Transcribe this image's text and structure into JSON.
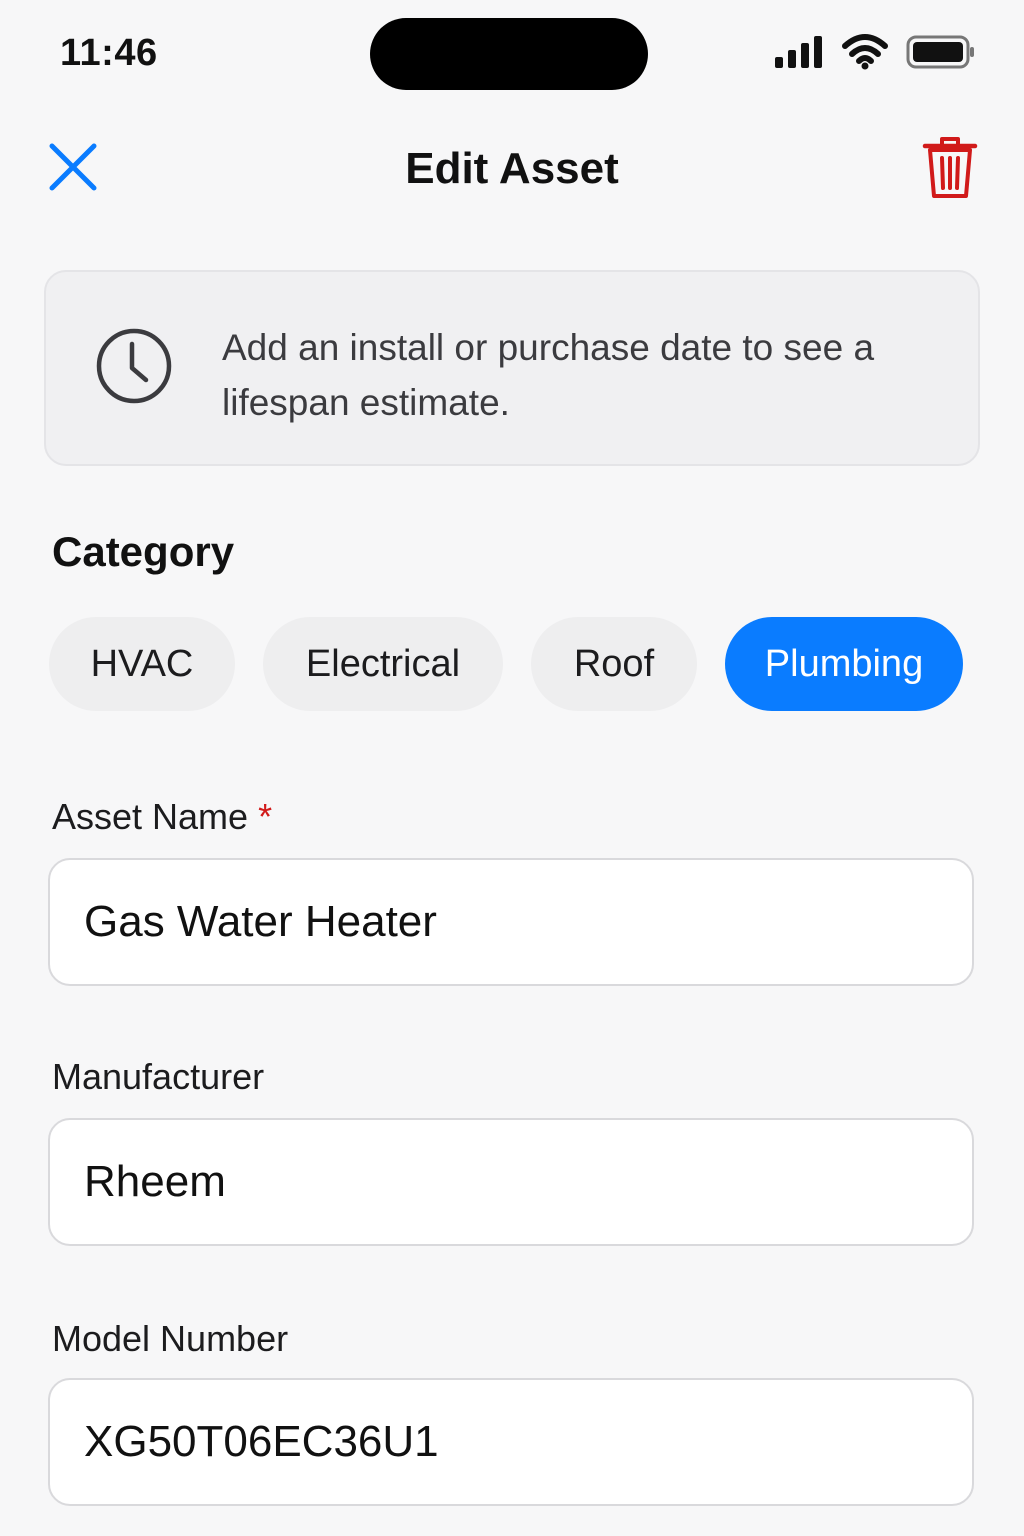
{
  "status_bar": {
    "time": "11:46"
  },
  "nav": {
    "title": "Edit Asset",
    "close_icon": "close-icon",
    "trash_icon": "trash-icon",
    "accent_color": "#0a7cff",
    "destructive_color": "#d11a1a"
  },
  "info_card": {
    "icon": "clock-icon",
    "text": "Add an install or purchase date to see a lifespan estimate."
  },
  "category": {
    "label": "Category",
    "options": [
      {
        "label": "HVAC",
        "selected": false
      },
      {
        "label": "Electrical",
        "selected": false
      },
      {
        "label": "Roof",
        "selected": false
      },
      {
        "label": "Plumbing",
        "selected": true
      }
    ]
  },
  "fields": {
    "asset_name": {
      "label": "Asset Name",
      "required_marker": "*",
      "value": "Gas Water Heater"
    },
    "manufacturer": {
      "label": "Manufacturer",
      "value": "Rheem"
    },
    "model_number": {
      "label": "Model Number",
      "value": "XG50T06EC36U1"
    }
  }
}
